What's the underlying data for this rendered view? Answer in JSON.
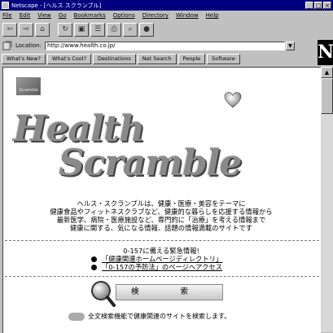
{
  "window": {
    "title": "Netscape - [ヘルス スクランブル]"
  },
  "menu": [
    "File",
    "Edit",
    "View",
    "Go",
    "Bookmarks",
    "Options",
    "Directory",
    "Window",
    "Help"
  ],
  "toolbar_icons": [
    "back-icon",
    "forward-icon",
    "home-icon",
    "reload-icon",
    "images-icon",
    "open-icon",
    "print-icon",
    "find-icon",
    "stop-icon"
  ],
  "location": {
    "label": "Location:",
    "url": "http://www.health.co.jp/"
  },
  "directory_buttons": [
    "What's New?",
    "What's Cool?",
    "Destinations",
    "Net Search",
    "People",
    "Software"
  ],
  "throbber_letter": "N",
  "page": {
    "logo_line1": "Health",
    "logo_line2": "Scramble",
    "intro_lines": [
      "ヘルス・スクランブルは、健康・医療・美容をテーマに",
      "健康食品やフィットネスクラブなど、健康的な暮らしを応援する情報から",
      "最新医学、病院・医療施設など、専門的に「治療」を考える情報まで",
      "健康に関する、気になる情報、話題の情報満載のサイトです"
    ],
    "notice_title": "0-157に備える緊急情報!",
    "notice_links": [
      "「健康関連ホームページディレクトリ」",
      "「0-157の予防法」のページへアクセス"
    ],
    "search_button": "検 索",
    "search_caption": "全文検索機能で健康関連のサイトを検索します。"
  }
}
